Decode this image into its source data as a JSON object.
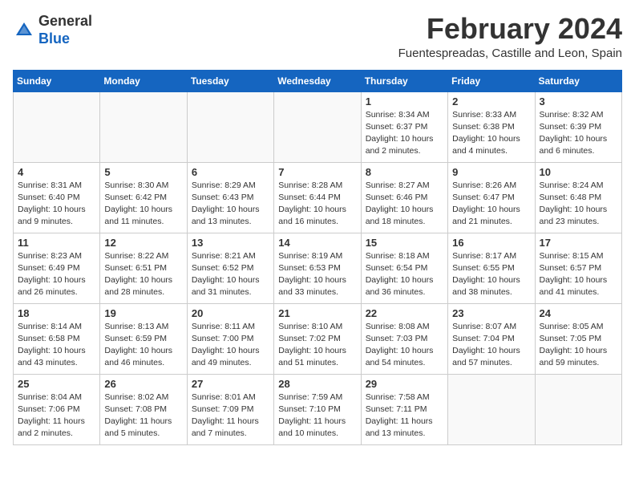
{
  "header": {
    "logo_general": "General",
    "logo_blue": "Blue",
    "month": "February 2024",
    "location": "Fuentespreadas, Castille and Leon, Spain"
  },
  "weekdays": [
    "Sunday",
    "Monday",
    "Tuesday",
    "Wednesday",
    "Thursday",
    "Friday",
    "Saturday"
  ],
  "weeks": [
    [
      {
        "day": "",
        "info": ""
      },
      {
        "day": "",
        "info": ""
      },
      {
        "day": "",
        "info": ""
      },
      {
        "day": "",
        "info": ""
      },
      {
        "day": "1",
        "info": "Sunrise: 8:34 AM\nSunset: 6:37 PM\nDaylight: 10 hours\nand 2 minutes."
      },
      {
        "day": "2",
        "info": "Sunrise: 8:33 AM\nSunset: 6:38 PM\nDaylight: 10 hours\nand 4 minutes."
      },
      {
        "day": "3",
        "info": "Sunrise: 8:32 AM\nSunset: 6:39 PM\nDaylight: 10 hours\nand 6 minutes."
      }
    ],
    [
      {
        "day": "4",
        "info": "Sunrise: 8:31 AM\nSunset: 6:40 PM\nDaylight: 10 hours\nand 9 minutes."
      },
      {
        "day": "5",
        "info": "Sunrise: 8:30 AM\nSunset: 6:42 PM\nDaylight: 10 hours\nand 11 minutes."
      },
      {
        "day": "6",
        "info": "Sunrise: 8:29 AM\nSunset: 6:43 PM\nDaylight: 10 hours\nand 13 minutes."
      },
      {
        "day": "7",
        "info": "Sunrise: 8:28 AM\nSunset: 6:44 PM\nDaylight: 10 hours\nand 16 minutes."
      },
      {
        "day": "8",
        "info": "Sunrise: 8:27 AM\nSunset: 6:46 PM\nDaylight: 10 hours\nand 18 minutes."
      },
      {
        "day": "9",
        "info": "Sunrise: 8:26 AM\nSunset: 6:47 PM\nDaylight: 10 hours\nand 21 minutes."
      },
      {
        "day": "10",
        "info": "Sunrise: 8:24 AM\nSunset: 6:48 PM\nDaylight: 10 hours\nand 23 minutes."
      }
    ],
    [
      {
        "day": "11",
        "info": "Sunrise: 8:23 AM\nSunset: 6:49 PM\nDaylight: 10 hours\nand 26 minutes."
      },
      {
        "day": "12",
        "info": "Sunrise: 8:22 AM\nSunset: 6:51 PM\nDaylight: 10 hours\nand 28 minutes."
      },
      {
        "day": "13",
        "info": "Sunrise: 8:21 AM\nSunset: 6:52 PM\nDaylight: 10 hours\nand 31 minutes."
      },
      {
        "day": "14",
        "info": "Sunrise: 8:19 AM\nSunset: 6:53 PM\nDaylight: 10 hours\nand 33 minutes."
      },
      {
        "day": "15",
        "info": "Sunrise: 8:18 AM\nSunset: 6:54 PM\nDaylight: 10 hours\nand 36 minutes."
      },
      {
        "day": "16",
        "info": "Sunrise: 8:17 AM\nSunset: 6:55 PM\nDaylight: 10 hours\nand 38 minutes."
      },
      {
        "day": "17",
        "info": "Sunrise: 8:15 AM\nSunset: 6:57 PM\nDaylight: 10 hours\nand 41 minutes."
      }
    ],
    [
      {
        "day": "18",
        "info": "Sunrise: 8:14 AM\nSunset: 6:58 PM\nDaylight: 10 hours\nand 43 minutes."
      },
      {
        "day": "19",
        "info": "Sunrise: 8:13 AM\nSunset: 6:59 PM\nDaylight: 10 hours\nand 46 minutes."
      },
      {
        "day": "20",
        "info": "Sunrise: 8:11 AM\nSunset: 7:00 PM\nDaylight: 10 hours\nand 49 minutes."
      },
      {
        "day": "21",
        "info": "Sunrise: 8:10 AM\nSunset: 7:02 PM\nDaylight: 10 hours\nand 51 minutes."
      },
      {
        "day": "22",
        "info": "Sunrise: 8:08 AM\nSunset: 7:03 PM\nDaylight: 10 hours\nand 54 minutes."
      },
      {
        "day": "23",
        "info": "Sunrise: 8:07 AM\nSunset: 7:04 PM\nDaylight: 10 hours\nand 57 minutes."
      },
      {
        "day": "24",
        "info": "Sunrise: 8:05 AM\nSunset: 7:05 PM\nDaylight: 10 hours\nand 59 minutes."
      }
    ],
    [
      {
        "day": "25",
        "info": "Sunrise: 8:04 AM\nSunset: 7:06 PM\nDaylight: 11 hours\nand 2 minutes."
      },
      {
        "day": "26",
        "info": "Sunrise: 8:02 AM\nSunset: 7:08 PM\nDaylight: 11 hours\nand 5 minutes."
      },
      {
        "day": "27",
        "info": "Sunrise: 8:01 AM\nSunset: 7:09 PM\nDaylight: 11 hours\nand 7 minutes."
      },
      {
        "day": "28",
        "info": "Sunrise: 7:59 AM\nSunset: 7:10 PM\nDaylight: 11 hours\nand 10 minutes."
      },
      {
        "day": "29",
        "info": "Sunrise: 7:58 AM\nSunset: 7:11 PM\nDaylight: 11 hours\nand 13 minutes."
      },
      {
        "day": "",
        "info": ""
      },
      {
        "day": "",
        "info": ""
      }
    ]
  ]
}
